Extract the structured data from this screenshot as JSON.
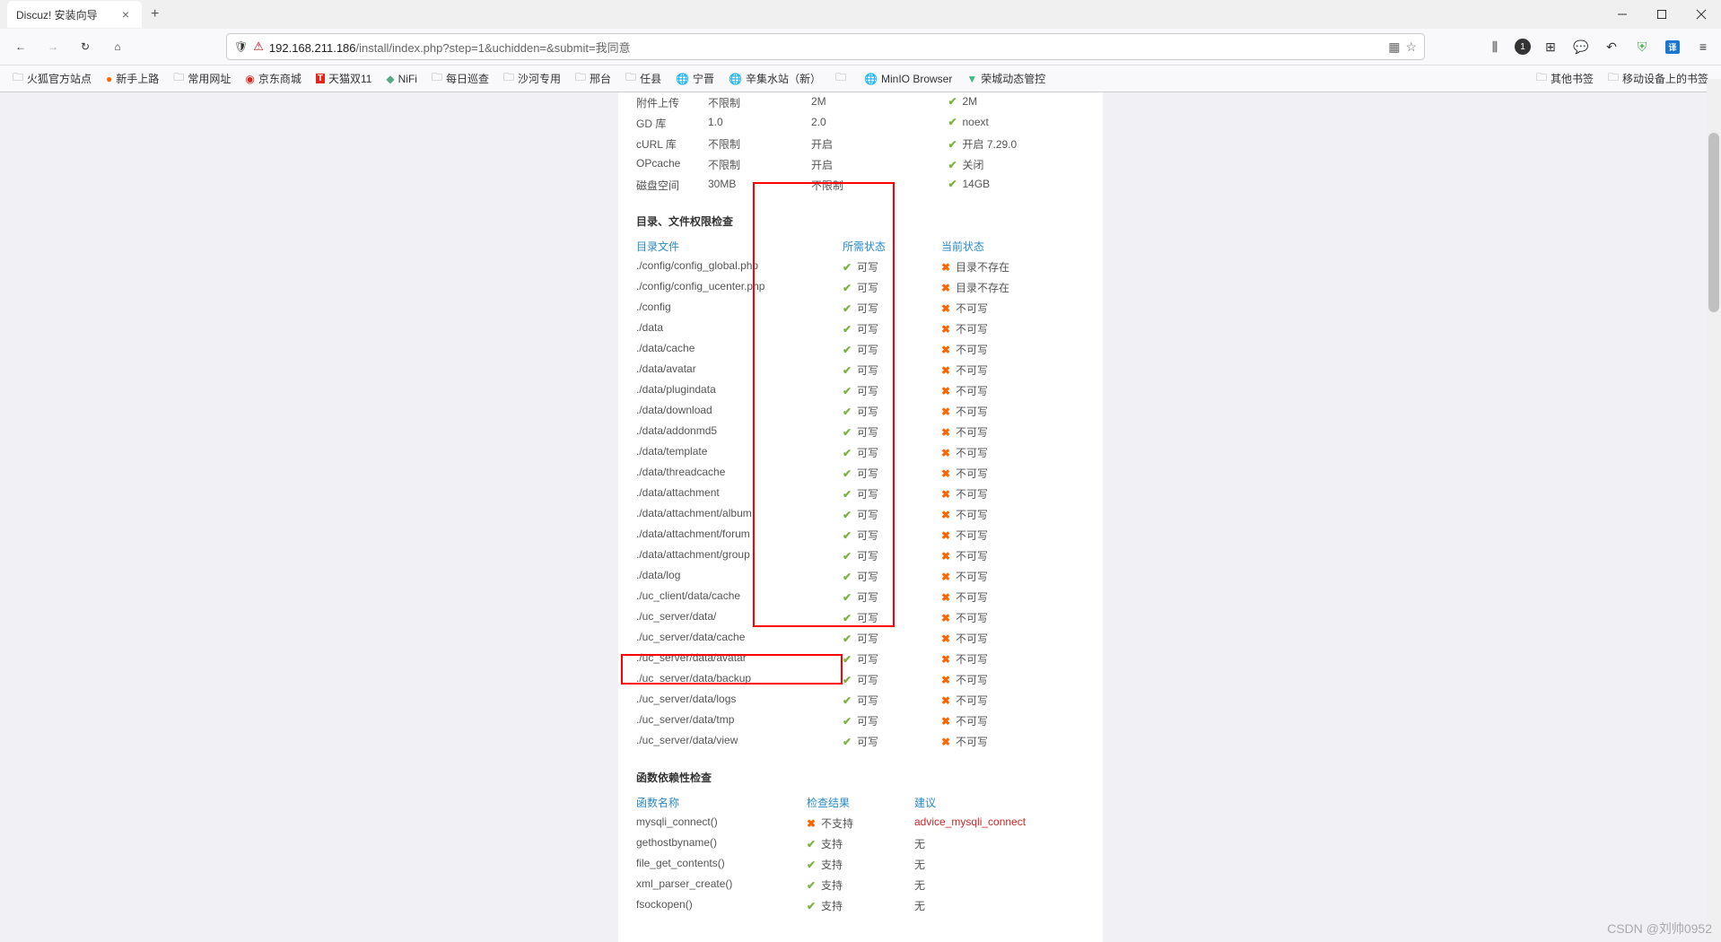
{
  "browser": {
    "tab_title": "Discuz! 安装向导",
    "url_host": "192.168.211.186",
    "url_path": "/install/index.php?step=1&uchidden=&submit=我同意"
  },
  "bookmarks": {
    "left": [
      {
        "label": "火狐官方站点",
        "icon": "folder"
      },
      {
        "label": "新手上路",
        "icon": "fire"
      },
      {
        "label": "常用网址",
        "icon": "folder"
      },
      {
        "label": "京东商城",
        "icon": "jd"
      },
      {
        "label": "天猫双11",
        "icon": "tmall"
      },
      {
        "label": "NiFi",
        "icon": "nifi"
      },
      {
        "label": "每日巡查",
        "icon": "folder"
      },
      {
        "label": "沙河专用",
        "icon": "folder"
      },
      {
        "label": "邢台",
        "icon": "folder"
      },
      {
        "label": "任县",
        "icon": "folder"
      },
      {
        "label": "宁晋",
        "icon": "globe"
      },
      {
        "label": "辛集水站（新）",
        "icon": "globe"
      },
      {
        "label": "",
        "icon": "folder"
      },
      {
        "label": "MinIO Browser",
        "icon": "globe"
      },
      {
        "label": "荣城动态管控",
        "icon": "vue"
      }
    ],
    "right": [
      {
        "label": "其他书签",
        "icon": "folder"
      },
      {
        "label": "移动设备上的书签",
        "icon": "folder"
      }
    ]
  },
  "env_check": {
    "rows": [
      {
        "name": "附件上传",
        "req": "不限制",
        "best": "2M",
        "cur": "2M",
        "ok": true
      },
      {
        "name": "GD 库",
        "req": "1.0",
        "best": "2.0",
        "cur": "noext",
        "ok": true
      },
      {
        "name": "cURL 库",
        "req": "不限制",
        "best": "开启",
        "cur": "开启 7.29.0",
        "ok": true
      },
      {
        "name": "OPcache",
        "req": "不限制",
        "best": "开启",
        "cur": "关闭",
        "ok": true
      },
      {
        "name": "磁盘空间",
        "req": "30MB",
        "best": "不限制",
        "cur": "14GB",
        "ok": true
      }
    ]
  },
  "perm_check": {
    "title": "目录、文件权限检查",
    "headers": {
      "col1": "目录文件",
      "col2": "所需状态",
      "col3": "当前状态"
    },
    "writable": "可写",
    "rows": [
      {
        "path": "./config/config_global.php",
        "cur": "目录不存在"
      },
      {
        "path": "./config/config_ucenter.php",
        "cur": "目录不存在"
      },
      {
        "path": "./config",
        "cur": "不可写"
      },
      {
        "path": "./data",
        "cur": "不可写"
      },
      {
        "path": "./data/cache",
        "cur": "不可写"
      },
      {
        "path": "./data/avatar",
        "cur": "不可写"
      },
      {
        "path": "./data/plugindata",
        "cur": "不可写"
      },
      {
        "path": "./data/download",
        "cur": "不可写"
      },
      {
        "path": "./data/addonmd5",
        "cur": "不可写"
      },
      {
        "path": "./data/template",
        "cur": "不可写"
      },
      {
        "path": "./data/threadcache",
        "cur": "不可写"
      },
      {
        "path": "./data/attachment",
        "cur": "不可写"
      },
      {
        "path": "./data/attachment/album",
        "cur": "不可写"
      },
      {
        "path": "./data/attachment/forum",
        "cur": "不可写"
      },
      {
        "path": "./data/attachment/group",
        "cur": "不可写"
      },
      {
        "path": "./data/log",
        "cur": "不可写"
      },
      {
        "path": "./uc_client/data/cache",
        "cur": "不可写"
      },
      {
        "path": "./uc_server/data/",
        "cur": "不可写"
      },
      {
        "path": "./uc_server/data/cache",
        "cur": "不可写"
      },
      {
        "path": "./uc_server/data/avatar",
        "cur": "不可写"
      },
      {
        "path": "./uc_server/data/backup",
        "cur": "不可写"
      },
      {
        "path": "./uc_server/data/logs",
        "cur": "不可写"
      },
      {
        "path": "./uc_server/data/tmp",
        "cur": "不可写"
      },
      {
        "path": "./uc_server/data/view",
        "cur": "不可写"
      }
    ]
  },
  "func_check": {
    "title": "函数依赖性检查",
    "headers": {
      "col1": "函数名称",
      "col2": "检查结果",
      "col3": "建议"
    },
    "supported": "支持",
    "unsupported": "不支持",
    "none": "无",
    "rows": [
      {
        "name": "mysqli_connect()",
        "ok": false,
        "advice": "advice_mysqli_connect"
      },
      {
        "name": "gethostbyname()",
        "ok": true,
        "advice": ""
      },
      {
        "name": "file_get_contents()",
        "ok": true,
        "advice": ""
      },
      {
        "name": "xml_parser_create()",
        "ok": true,
        "advice": ""
      },
      {
        "name": "fsockopen()",
        "ok": true,
        "advice": ""
      }
    ]
  },
  "watermark": "CSDN @刘帅0952"
}
